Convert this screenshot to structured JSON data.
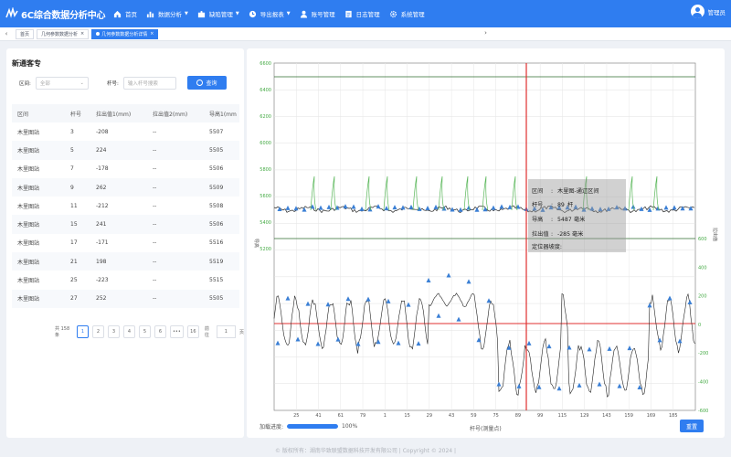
{
  "app": {
    "title": "6C综合数据分析中心",
    "user": "管理员"
  },
  "nav": [
    {
      "label": "首页",
      "icon": "home-icon",
      "has_caret": false
    },
    {
      "label": "数据分析",
      "icon": "bar-chart-icon",
      "has_caret": true
    },
    {
      "label": "缺陷管理",
      "icon": "puzzle-icon",
      "has_caret": true
    },
    {
      "label": "导出报表",
      "icon": "clock-icon",
      "has_caret": true
    },
    {
      "label": "账号管理",
      "icon": "user-icon",
      "has_caret": false
    },
    {
      "label": "日志管理",
      "icon": "log-icon",
      "has_caret": false
    },
    {
      "label": "系统管理",
      "icon": "gear-icon",
      "has_caret": false
    }
  ],
  "tabs": [
    {
      "label": "首页",
      "active": false,
      "closable": false
    },
    {
      "label": "几何参数数据分析",
      "active": false,
      "closable": true
    },
    {
      "label": "几何参数数据分析详情",
      "active": true,
      "closable": true
    }
  ],
  "left": {
    "title": "新通客专",
    "filter": {
      "section_label": "区间:",
      "section_value": "全部",
      "pole_label": "杆号:",
      "pole_placeholder": "输入杆号搜索",
      "query_button": "查询"
    },
    "table": {
      "columns": [
        "区间",
        "杆号",
        "拉出值1(mm)",
        "拉出值2(mm)",
        "导高1(mm"
      ],
      "rows": [
        [
          "木里图站",
          "3",
          "-208",
          "--",
          "5507"
        ],
        [
          "木里图站",
          "5",
          "224",
          "--",
          "5505"
        ],
        [
          "木里图站",
          "7",
          "-178",
          "--",
          "5506"
        ],
        [
          "木里图站",
          "9",
          "262",
          "--",
          "5509"
        ],
        [
          "木里图站",
          "11",
          "-212",
          "--",
          "5508"
        ],
        [
          "木里图站",
          "15",
          "241",
          "--",
          "5506"
        ],
        [
          "木里图站",
          "17",
          "-171",
          "--",
          "5516"
        ],
        [
          "木里图站",
          "21",
          "198",
          "--",
          "5519"
        ],
        [
          "木里图站",
          "25",
          "-223",
          "--",
          "5515"
        ],
        [
          "木里图站",
          "27",
          "252",
          "--",
          "5505"
        ]
      ]
    },
    "pager": {
      "total": "共 158 条",
      "pages": [
        "1",
        "2",
        "3",
        "4",
        "5",
        "6",
        "•••",
        "16"
      ],
      "active": "1",
      "goto_label": "前往",
      "goto_value": "1",
      "page_suffix": "页"
    }
  },
  "chart": {
    "left_axis_title": "导高",
    "right_axis_title": "拉出值",
    "x_axis_title": "杆号(测量点)",
    "left_ticks": [
      "6600",
      "6400",
      "6200",
      "6000",
      "5800",
      "5600",
      "5400",
      "5200"
    ],
    "right_ticks": [
      "600",
      "400",
      "200",
      "0",
      "-200",
      "-400",
      "-600"
    ],
    "x_ticks": [
      "25",
      "41",
      "61",
      "79",
      "1",
      "15",
      "29",
      "43",
      "59",
      "75",
      "89",
      "99",
      "115",
      "129",
      "143",
      "159",
      "169",
      "185"
    ],
    "tooltip": {
      "section_label": "区间",
      "section_value": "木里图-通辽区间",
      "pole_label": "杆号",
      "pole_value": "89",
      "pole_unit": "杆",
      "height_label": "导高",
      "height_value": "5487",
      "height_unit": "毫米",
      "stagger_label": "拉出值",
      "stagger_value": "-285",
      "stagger_unit": "毫米",
      "locator_label": "定位器坡度:"
    },
    "progress_label": "加载进度:",
    "progress_value": 100,
    "progress_text": "100%",
    "reset_button": "重置",
    "colors": {
      "line": "#222222",
      "marker": "#3a7fd5",
      "spike": "#5cb85c",
      "cursor": "#e03030",
      "limit": "#2f6b2f"
    }
  },
  "footer": "© 版权所有：湖南华致联盟数据科技开发有限公司 | Copyright © 2024 |"
}
